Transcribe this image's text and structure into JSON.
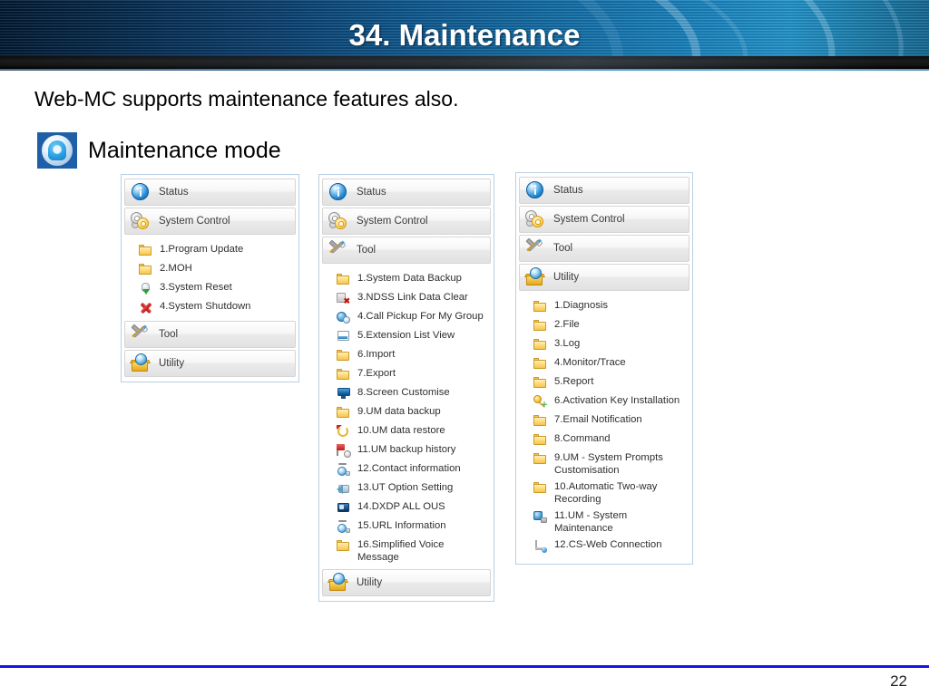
{
  "header": {
    "title": "34. Maintenance"
  },
  "body": {
    "intro": "Web-MC supports maintenance features also.",
    "mode_label": "Maintenance mode",
    "mode_icon": "maintenance-mode-icon"
  },
  "panels": [
    {
      "id": "panel-1",
      "headers_before": [
        {
          "label": "Status",
          "icon": "info-icon"
        },
        {
          "label": "System Control",
          "icon": "gears-icon"
        }
      ],
      "items": [
        {
          "label": "1.Program Update",
          "icon": "folder-icon"
        },
        {
          "label": "2.MOH",
          "icon": "folder-icon"
        },
        {
          "label": "3.System Reset",
          "icon": "power-reset-icon"
        },
        {
          "label": "4.System Shutdown",
          "icon": "red-x-icon"
        }
      ],
      "headers_after": [
        {
          "label": "Tool",
          "icon": "tools-icon"
        },
        {
          "label": "Utility",
          "icon": "utility-box-icon"
        }
      ]
    },
    {
      "id": "panel-2",
      "headers_before": [
        {
          "label": "Status",
          "icon": "info-icon"
        },
        {
          "label": "System Control",
          "icon": "gears-icon"
        },
        {
          "label": "Tool",
          "icon": "tools-icon"
        }
      ],
      "items": [
        {
          "label": "1.System Data Backup",
          "icon": "folder-icon"
        },
        {
          "label": "3.NDSS Link Data Clear",
          "icon": "document-delete-icon"
        },
        {
          "label": "4.Call Pickup For My Group",
          "icon": "people-icon"
        },
        {
          "label": "5.Extension List View",
          "icon": "window-list-icon"
        },
        {
          "label": "6.Import",
          "icon": "folder-icon"
        },
        {
          "label": "7.Export",
          "icon": "folder-icon"
        },
        {
          "label": "8.Screen Customise",
          "icon": "monitor-icon"
        },
        {
          "label": "9.UM data backup",
          "icon": "folder-icon"
        },
        {
          "label": "10.UM data restore",
          "icon": "restore-icon"
        },
        {
          "label": "11.UM backup history",
          "icon": "flag-history-icon"
        },
        {
          "label": "12.Contact information",
          "icon": "contact-info-icon"
        },
        {
          "label": "13.UT Option Setting",
          "icon": "option-setting-icon"
        },
        {
          "label": "14.DXDP ALL OUS",
          "icon": "device-icon"
        },
        {
          "label": "15.URL Information",
          "icon": "contact-info-icon"
        },
        {
          "label": "16.Simplified Voice Message",
          "icon": "folder-icon"
        }
      ],
      "headers_after": [
        {
          "label": "Utility",
          "icon": "utility-box-icon"
        }
      ]
    },
    {
      "id": "panel-3",
      "headers_before": [
        {
          "label": "Status",
          "icon": "info-icon"
        },
        {
          "label": "System Control",
          "icon": "gears-icon"
        },
        {
          "label": "Tool",
          "icon": "tools-icon"
        },
        {
          "label": "Utility",
          "icon": "utility-box-icon"
        }
      ],
      "items": [
        {
          "label": "1.Diagnosis",
          "icon": "folder-icon"
        },
        {
          "label": "2.File",
          "icon": "folder-icon"
        },
        {
          "label": "3.Log",
          "icon": "folder-icon"
        },
        {
          "label": "4.Monitor/Trace",
          "icon": "folder-icon"
        },
        {
          "label": "5.Report",
          "icon": "folder-icon"
        },
        {
          "label": "6.Activation Key Installation",
          "icon": "activation-key-icon"
        },
        {
          "label": "7.Email Notification",
          "icon": "folder-icon"
        },
        {
          "label": "8.Command",
          "icon": "folder-icon"
        },
        {
          "label": "9.UM - System Prompts Customisation",
          "icon": "folder-icon"
        },
        {
          "label": "10.Automatic Two-way Recording",
          "icon": "folder-icon"
        },
        {
          "label": "11.UM - System Maintenance",
          "icon": "um-maintenance-icon"
        },
        {
          "label": "12.CS-Web Connection",
          "icon": "connection-icon"
        }
      ],
      "headers_after": []
    }
  ],
  "footer": {
    "page_number": "22",
    "accent_color": "#1414e6"
  }
}
